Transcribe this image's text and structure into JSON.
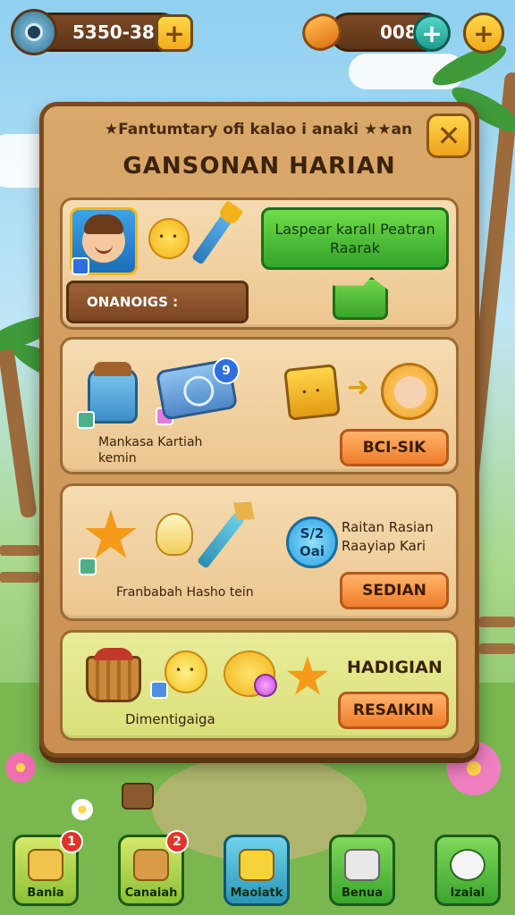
{
  "top_bar": {
    "currency_left": "5350-38",
    "currency_right": "008",
    "add_symbol": "+"
  },
  "panel": {
    "banner": "★Fantumtary ofi kalao i anaki ★★an",
    "close_symbol": "✕",
    "title": "GANSONAN HARIAN"
  },
  "cards": [
    {
      "primary_button": "Laspear karall Peatran Raarak",
      "secondary_bar": "ONANOIGS :"
    },
    {
      "label": "Mankasa Kartiah kemin",
      "badge": "9",
      "button": "BCI-SIK"
    },
    {
      "label": "Franbabah Hasho tein",
      "timer": "S/2 Oai",
      "info": "Raitan Rasian Raayiap Kari",
      "button": "SEDIAN"
    },
    {
      "label": "Dimentigaiga",
      "heading": "HADIGIAN",
      "button": "RESAIKIN"
    }
  ],
  "bottom_nav": [
    {
      "label": "Bania",
      "badge": "1",
      "icon": "bag-icon"
    },
    {
      "label": "Canaiah",
      "badge": "2",
      "icon": "shop-icon"
    },
    {
      "label": "Maoiatk",
      "badge": "",
      "icon": "map-icon"
    },
    {
      "label": "Benua",
      "badge": "",
      "icon": "flag-icon"
    },
    {
      "label": "lzaial",
      "badge": "",
      "icon": "gear-icon"
    }
  ],
  "colors": {
    "panel": "#c98f52",
    "green_button": "#34a32a",
    "orange_button": "#ef7d2a",
    "accent_yellow": "#f2a91b"
  }
}
